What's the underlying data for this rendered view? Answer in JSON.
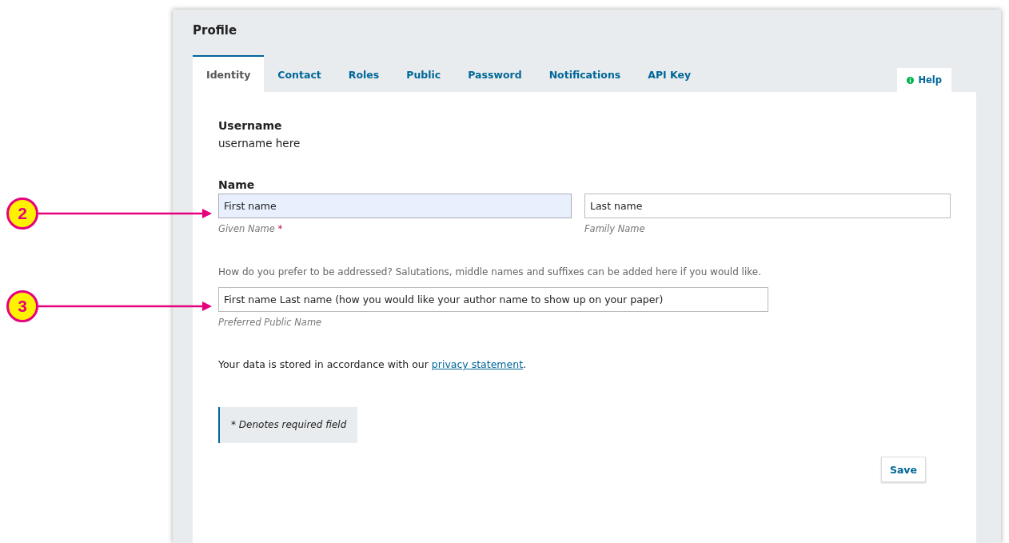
{
  "callouts": [
    {
      "number": "2"
    },
    {
      "number": "3"
    }
  ],
  "title": "Profile",
  "tabs": [
    {
      "label": "Identity",
      "selected": true
    },
    {
      "label": "Contact",
      "selected": false
    },
    {
      "label": "Roles",
      "selected": false
    },
    {
      "label": "Public",
      "selected": false
    },
    {
      "label": "Password",
      "selected": false
    },
    {
      "label": "Notifications",
      "selected": false
    },
    {
      "label": "API Key",
      "selected": false
    }
  ],
  "help": {
    "label": "Help"
  },
  "username": {
    "label": "Username",
    "value": "username here"
  },
  "name": {
    "label": "Name",
    "given": {
      "value": "First name",
      "hint": "Given Name",
      "required_mark": "*",
      "focused": true
    },
    "family": {
      "value": "Last name",
      "hint": "Family Name",
      "focused": false
    }
  },
  "preferred": {
    "description": "How do you prefer to be addressed? Salutations, middle names and suffixes can be added here if you would like.",
    "value": "First name Last name (how you would like your author name to show up on your paper)",
    "hint": "Preferred Public Name"
  },
  "privacy": {
    "before": "Your data is stored in accordance with our ",
    "link": "privacy statement",
    "after": "."
  },
  "note": "* Denotes required field",
  "save": "Save"
}
